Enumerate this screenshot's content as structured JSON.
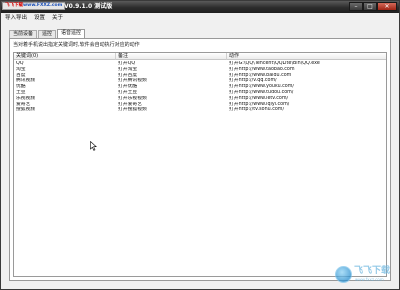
{
  "titlebar": {
    "brand_prefix": "飞飞下载",
    "brand_site": "www.FXXZ.com",
    "title": "V0.9.1.0 测试版",
    "minimize_glyph": "–",
    "maximize_glyph": "□",
    "close_glyph": "✕"
  },
  "menubar": {
    "items": [
      "导入导出",
      "设置",
      "关于"
    ]
  },
  "tabs": [
    {
      "label": "当前设备",
      "active": false
    },
    {
      "label": "遥控",
      "active": false
    },
    {
      "label": "语音遥控",
      "active": true
    }
  ],
  "panel": {
    "hint": "当对着手机说出指定关键词时,软件会自动执行对应的动作"
  },
  "table": {
    "columns": [
      "关键词(0)",
      "备注",
      "动作"
    ],
    "rows": [
      [
        "QQ",
        "打开QQ",
        "打开G:\\QQ\\Tencent\\QQLite\\Bin\\QQ.exe"
      ],
      [
        "淘宝",
        "打开淘宝",
        "打开http://www.taobao.com"
      ],
      [
        "百度",
        "打开百度",
        "打开http://www.baidu.com"
      ],
      [
        "腾讯视频",
        "打开腾讯视频",
        "打开http://v.qq.com/"
      ],
      [
        "优酷",
        "打开优酷",
        "打开http://www.youku.com/"
      ],
      [
        "土豆",
        "打开土豆",
        "打开http://www.tudou.com/"
      ],
      [
        "乐视视频",
        "打开乐视视频",
        "打开http://www.letv.com/"
      ],
      [
        "爱奇艺",
        "打开爱奇艺",
        "打开http://www.iqiyi.com/"
      ],
      [
        "搜狐视频",
        "打开搜狐视频",
        "打开http://tv.sohu.com/"
      ]
    ]
  },
  "watermark": {
    "text": "飞飞下载",
    "sub": "www.fxxz.com"
  }
}
